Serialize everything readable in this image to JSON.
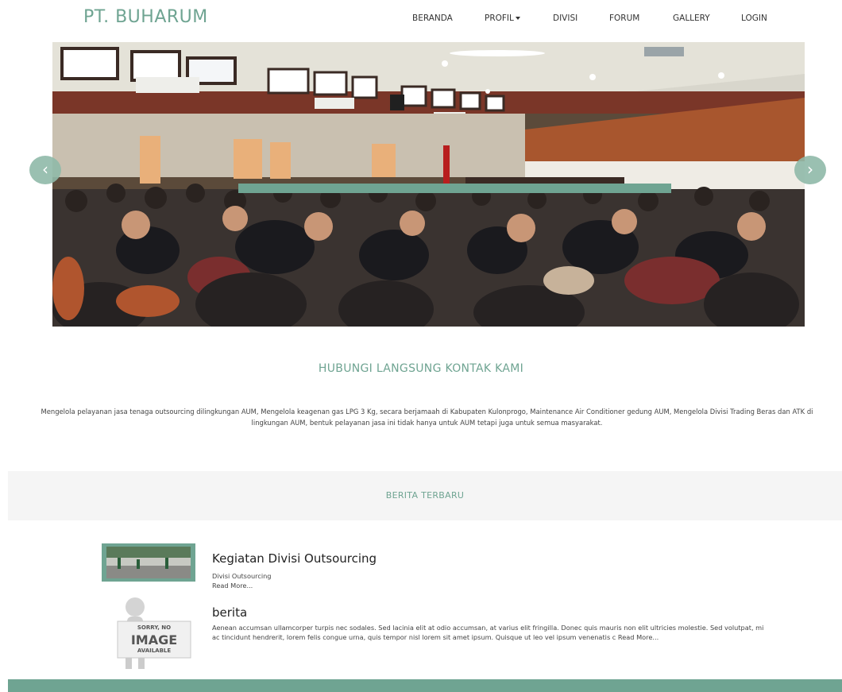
{
  "header": {
    "brand": "PT. BUHARUM",
    "nav": [
      {
        "label": "BERANDA"
      },
      {
        "label": "PROFIL"
      },
      {
        "label": "DIVISI"
      },
      {
        "label": "FORUM"
      },
      {
        "label": "GALLERY"
      },
      {
        "label": "LOGIN"
      }
    ]
  },
  "carousel": {
    "prev_icon": "chevron-left-icon",
    "next_icon": "chevron-right-icon",
    "prev_glyph": "‹",
    "next_glyph": "›"
  },
  "contact": {
    "heading": "HUBUNGI LANGSUNG KONTAK KAMI",
    "text": "Mengelola pelayanan jasa tenaga outsourcing dilingkungan AUM, Mengelola keagenan gas LPG 3 Kg, secara berjamaah di Kabupaten Kulonprogo, Maintenance Air Conditioner gedung AUM, Mengelola Divisi Trading Beras dan ATK di lingkungan AUM, bentuk pelayanan jasa ini tidak hanya untuk AUM tetapi juga untuk semua masyarakat."
  },
  "news": {
    "heading": "BERITA TERBARU",
    "items": [
      {
        "title": "Kegiatan Divisi Outsourcing",
        "category": "Divisi Outsourcing",
        "read_more": "Read More..."
      },
      {
        "title": "berita",
        "excerpt": "Aenean accumsan ullamcorper turpis nec sodales. Sed lacinia elit at odio accumsan, at varius elit fringilla. Donec quis mauris non elit ultricies molestie. Sed volutpat, mi ac tincidunt hendrerit, lorem felis congue urna, quis tempor nisl lorem sit amet ipsum. Quisque ut leo vel ipsum venenatis c Read More...",
        "placeholder": {
          "line1": "SORRY, NO",
          "line2": "IMAGE",
          "line3": "AVAILABLE"
        }
      }
    ]
  },
  "colors": {
    "accent": "#6fa492",
    "band": "#f5f5f5"
  }
}
